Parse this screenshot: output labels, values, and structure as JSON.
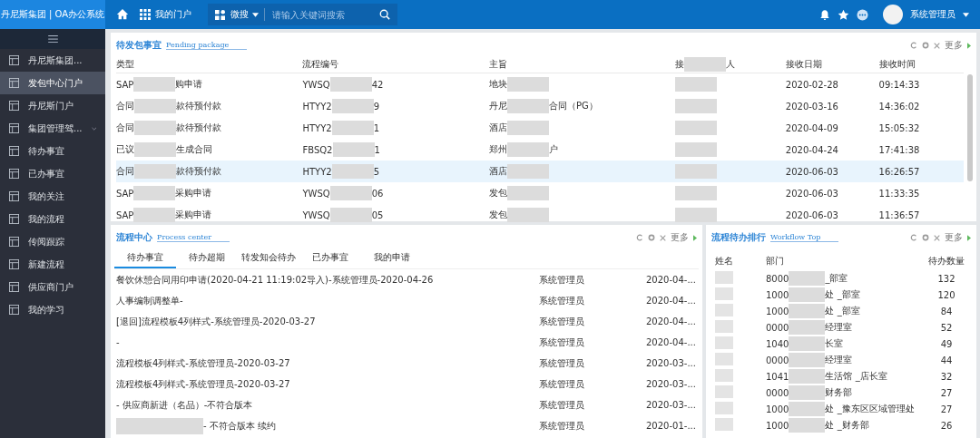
{
  "header": {
    "logo": "丹尼斯集团 | OA办公系统",
    "portal": "我的门户",
    "search_scope": "微搜",
    "search_placeholder": "请输入关键词搜索",
    "user": "系统管理员"
  },
  "sidebar": {
    "items": [
      {
        "label": "丹尼斯集团...",
        "selected": false,
        "kind": "link"
      },
      {
        "label": "发包中心门户",
        "selected": true,
        "kind": "link"
      },
      {
        "label": "丹尼斯门户",
        "selected": false,
        "kind": "link"
      },
      {
        "label": "集团管理驾...",
        "selected": false,
        "kind": "group"
      },
      {
        "label": "待办事宜",
        "selected": false,
        "kind": "link"
      },
      {
        "label": "已办事宜",
        "selected": false,
        "kind": "link"
      },
      {
        "label": "我的关注",
        "selected": false,
        "kind": "link"
      },
      {
        "label": "我的流程",
        "selected": false,
        "kind": "link"
      },
      {
        "label": "传阅跟踪",
        "selected": false,
        "kind": "link"
      },
      {
        "label": "新建流程",
        "selected": false,
        "kind": "link"
      },
      {
        "label": "供应商门户",
        "selected": false,
        "kind": "link"
      },
      {
        "label": "我的学习",
        "selected": false,
        "kind": "link"
      }
    ]
  },
  "pending": {
    "title": "待发包事宜",
    "subtitle": "Pending package",
    "more": "更多",
    "columns": [
      {
        "parts": [
          {
            "kind": "text",
            "text": "类型"
          }
        ]
      },
      {
        "parts": [
          {
            "kind": "text",
            "text": "流程编号"
          }
        ]
      },
      {
        "parts": [
          {
            "kind": "text",
            "text": "主旨"
          }
        ]
      },
      {
        "parts": [
          {
            "kind": "text",
            "text": "接"
          },
          {
            "kind": "blur"
          },
          {
            "kind": "text",
            "text": "人"
          }
        ]
      },
      {
        "parts": [
          {
            "kind": "text",
            "text": "接收日期"
          }
        ]
      },
      {
        "parts": [
          {
            "kind": "text",
            "text": "接收时间"
          }
        ]
      }
    ],
    "rows": [
      {
        "selected": false,
        "cells": [
          [
            {
              "kind": "text",
              "text": "SAP"
            },
            {
              "kind": "blur"
            },
            {
              "kind": "text",
              "text": "购申请"
            }
          ],
          [
            {
              "kind": "text",
              "text": "YWSQ"
            },
            {
              "kind": "blur"
            },
            {
              "kind": "text",
              "text": "42"
            }
          ],
          [
            {
              "kind": "text",
              "text": "地块"
            },
            {
              "kind": "blur"
            }
          ],
          [
            {
              "kind": "blur"
            }
          ],
          [
            {
              "kind": "text",
              "text": "2020-02-28"
            }
          ],
          [
            {
              "kind": "text",
              "text": "09:14:33"
            }
          ]
        ]
      },
      {
        "selected": false,
        "cells": [
          [
            {
              "kind": "text",
              "text": "合同"
            },
            {
              "kind": "blur"
            },
            {
              "kind": "text",
              "text": "款待预付款"
            }
          ],
          [
            {
              "kind": "text",
              "text": "HTYY2"
            },
            {
              "kind": "blur"
            },
            {
              "kind": "text",
              "text": "9"
            }
          ],
          [
            {
              "kind": "text",
              "text": "丹尼"
            },
            {
              "kind": "blur"
            },
            {
              "kind": "text",
              "text": "合同（PG）"
            }
          ],
          [
            {
              "kind": "blur"
            }
          ],
          [
            {
              "kind": "text",
              "text": "2020-03-16"
            }
          ],
          [
            {
              "kind": "text",
              "text": "14:36:02"
            }
          ]
        ]
      },
      {
        "selected": false,
        "cells": [
          [
            {
              "kind": "text",
              "text": "合同"
            },
            {
              "kind": "blur"
            },
            {
              "kind": "text",
              "text": "款待预付款"
            }
          ],
          [
            {
              "kind": "text",
              "text": "HTYY2"
            },
            {
              "kind": "blur"
            },
            {
              "kind": "text",
              "text": "1"
            }
          ],
          [
            {
              "kind": "text",
              "text": "酒店"
            },
            {
              "kind": "blur"
            }
          ],
          [
            {
              "kind": "blur"
            }
          ],
          [
            {
              "kind": "text",
              "text": "2020-04-09"
            }
          ],
          [
            {
              "kind": "text",
              "text": "15:05:32"
            }
          ]
        ]
      },
      {
        "selected": false,
        "cells": [
          [
            {
              "kind": "text",
              "text": "已议"
            },
            {
              "kind": "blur"
            },
            {
              "kind": "text",
              "text": "生成合同"
            }
          ],
          [
            {
              "kind": "text",
              "text": "FBSQ2"
            },
            {
              "kind": "blur"
            },
            {
              "kind": "text",
              "text": "1"
            }
          ],
          [
            {
              "kind": "text",
              "text": "郑州"
            },
            {
              "kind": "blur"
            },
            {
              "kind": "text",
              "text": "户"
            }
          ],
          [
            {
              "kind": "blur"
            }
          ],
          [
            {
              "kind": "text",
              "text": "2020-04-24"
            }
          ],
          [
            {
              "kind": "text",
              "text": "17:41:38"
            }
          ]
        ]
      },
      {
        "selected": true,
        "cells": [
          [
            {
              "kind": "text",
              "text": "合同"
            },
            {
              "kind": "blur"
            },
            {
              "kind": "text",
              "text": "款待预付款"
            }
          ],
          [
            {
              "kind": "text",
              "text": "HTYY2"
            },
            {
              "kind": "blur"
            },
            {
              "kind": "text",
              "text": "5"
            }
          ],
          [
            {
              "kind": "text",
              "text": "酒店"
            },
            {
              "kind": "blur"
            }
          ],
          [
            {
              "kind": "blur"
            }
          ],
          [
            {
              "kind": "text",
              "text": "2020-06-03"
            }
          ],
          [
            {
              "kind": "text",
              "text": "16:26:57"
            }
          ]
        ]
      },
      {
        "selected": false,
        "cells": [
          [
            {
              "kind": "text",
              "text": "SAP"
            },
            {
              "kind": "blur"
            },
            {
              "kind": "text",
              "text": "采购申请"
            }
          ],
          [
            {
              "kind": "text",
              "text": "YWSQ"
            },
            {
              "kind": "blur"
            },
            {
              "kind": "text",
              "text": "06"
            }
          ],
          [
            {
              "kind": "text",
              "text": "发包"
            },
            {
              "kind": "blur"
            }
          ],
          [
            {
              "kind": "blur"
            }
          ],
          [
            {
              "kind": "text",
              "text": "2020-06-03"
            }
          ],
          [
            {
              "kind": "text",
              "text": "11:33:35"
            }
          ]
        ]
      },
      {
        "selected": false,
        "cells": [
          [
            {
              "kind": "text",
              "text": "SAP"
            },
            {
              "kind": "blur"
            },
            {
              "kind": "text",
              "text": "采购申请"
            }
          ],
          [
            {
              "kind": "text",
              "text": "YWSQ"
            },
            {
              "kind": "blur"
            },
            {
              "kind": "text",
              "text": "05"
            }
          ],
          [
            {
              "kind": "text",
              "text": "发包"
            },
            {
              "kind": "blur"
            }
          ],
          [
            {
              "kind": "blur"
            }
          ],
          [
            {
              "kind": "text",
              "text": "2020-06-03"
            }
          ],
          [
            {
              "kind": "text",
              "text": "11:36:57"
            }
          ]
        ]
      }
    ]
  },
  "process": {
    "title": "流程中心",
    "subtitle": "Process center",
    "more": "更多",
    "tabs": [
      {
        "label": "待办事宜",
        "selected": true
      },
      {
        "label": "待办超期",
        "selected": false
      },
      {
        "label": "转发知会待办",
        "selected": false
      },
      {
        "label": "已办事宜",
        "selected": false
      },
      {
        "label": "我的申请",
        "selected": false
      }
    ],
    "rows": [
      {
        "title": [
          {
            "kind": "text",
            "text": "餐饮休憩合同用印申请(2020-04-21 11:19:02导入)-系统管理员-2020-04-26"
          }
        ],
        "person": "系统管理员",
        "date": "2020-04-..."
      },
      {
        "title": [
          {
            "kind": "text",
            "text": "人事编制调整单-"
          }
        ],
        "person": "系统管理员",
        "date": "2020-04-..."
      },
      {
        "title": [
          {
            "kind": "text",
            "text": "[退回]流程模板4列样式-系统管理员-2020-03-27"
          }
        ],
        "person": "系统管理员",
        "date": "2020-04-..."
      },
      {
        "title": [
          {
            "kind": "text",
            "text": "-"
          }
        ],
        "person": "系统管理员",
        "date": "2020-04-..."
      },
      {
        "title": [
          {
            "kind": "text",
            "text": "流程模板4列样式-系统管理员-2020-03-27"
          }
        ],
        "person": "系统管理员",
        "date": "2020-03-..."
      },
      {
        "title": [
          {
            "kind": "text",
            "text": "流程模板4列样式-系统管理员-2020-03-27"
          }
        ],
        "person": "系统管理员",
        "date": "2020-03-..."
      },
      {
        "title": [
          {
            "kind": "text",
            "text": "- 供应商新进（名品）-不符合版本"
          }
        ],
        "person": "系统管理员",
        "date": "2020-03-..."
      },
      {
        "title": [
          {
            "kind": "blur"
          },
          {
            "kind": "text",
            "text": "- 不符合版本 续约"
          }
        ],
        "person": "系统管理员",
        "date": "2020-01-..."
      }
    ]
  },
  "ranking": {
    "title": "流程待办排行",
    "subtitle": "Workflow Top",
    "more": "更多",
    "columns": [
      "姓名",
      "部门",
      "待办数量"
    ],
    "rows": [
      {
        "dept": [
          {
            "kind": "text",
            "text": "8000"
          },
          {
            "kind": "blur"
          },
          {
            "kind": "text",
            "text": "_部室"
          }
        ],
        "count": "132"
      },
      {
        "dept": [
          {
            "kind": "text",
            "text": "1000"
          },
          {
            "kind": "blur"
          },
          {
            "kind": "text",
            "text": "处 _部室"
          }
        ],
        "count": "120"
      },
      {
        "dept": [
          {
            "kind": "text",
            "text": "1000"
          },
          {
            "kind": "blur"
          },
          {
            "kind": "text",
            "text": "处 _部室"
          }
        ],
        "count": "84"
      },
      {
        "dept": [
          {
            "kind": "text",
            "text": "0000"
          },
          {
            "kind": "blur"
          },
          {
            "kind": "text",
            "text": "经理室"
          }
        ],
        "count": "52"
      },
      {
        "dept": [
          {
            "kind": "text",
            "text": "1040"
          },
          {
            "kind": "blur"
          },
          {
            "kind": "text",
            "text": "长室"
          }
        ],
        "count": "49"
      },
      {
        "dept": [
          {
            "kind": "text",
            "text": "0000"
          },
          {
            "kind": "blur"
          },
          {
            "kind": "text",
            "text": "经理室"
          }
        ],
        "count": "44"
      },
      {
        "dept": [
          {
            "kind": "text",
            "text": "1041"
          },
          {
            "kind": "blur"
          },
          {
            "kind": "text",
            "text": "生活馆 _店长室"
          }
        ],
        "count": "32"
      },
      {
        "dept": [
          {
            "kind": "text",
            "text": "0000"
          },
          {
            "kind": "blur"
          },
          {
            "kind": "text",
            "text": "财务部"
          }
        ],
        "count": "27"
      },
      {
        "dept": [
          {
            "kind": "text",
            "text": "1000"
          },
          {
            "kind": "blur"
          },
          {
            "kind": "text",
            "text": "处 _豫东区区域管理处"
          }
        ],
        "count": "27"
      },
      {
        "dept": [
          {
            "kind": "text",
            "text": "1000"
          },
          {
            "kind": "blur"
          },
          {
            "kind": "text",
            "text": "处 _财务部"
          }
        ],
        "count": "26"
      }
    ]
  }
}
